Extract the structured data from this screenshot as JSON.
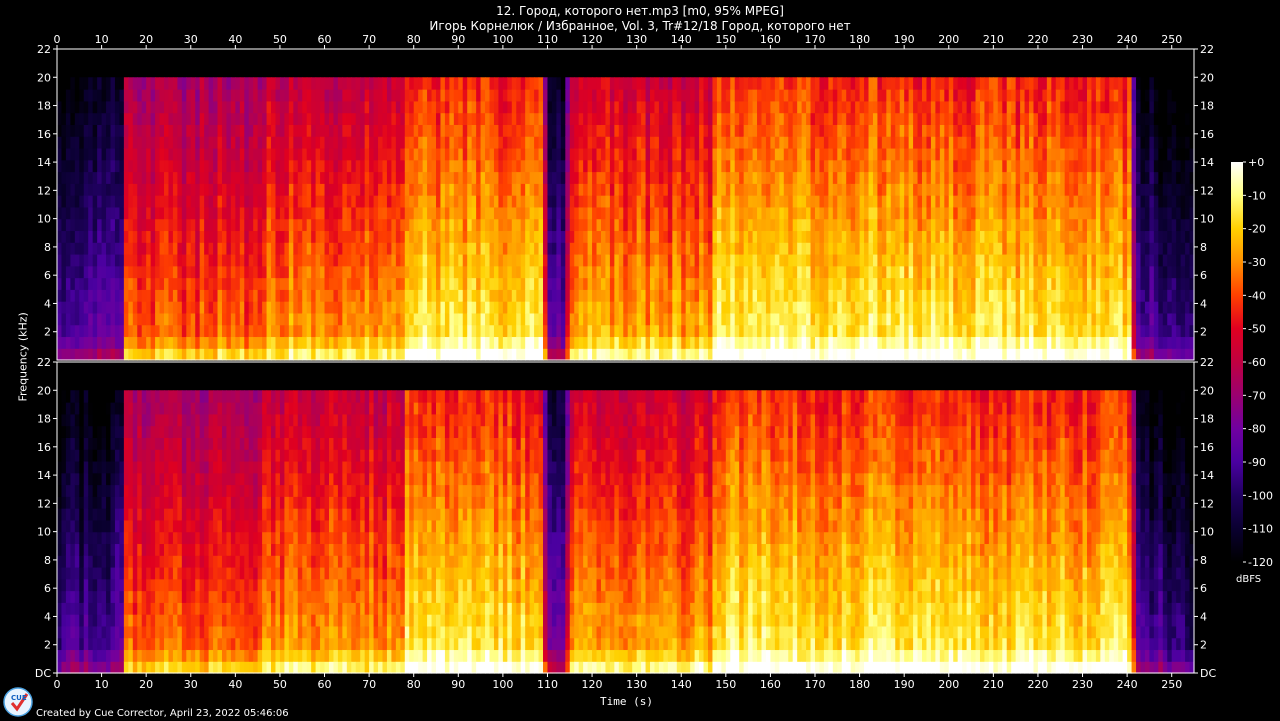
{
  "title": {
    "line1": "12. Город, которого нет.mp3 [m0, 95% MPEG]",
    "line2": "Игорь Корнелюк / Избранное, Vol. 3, Tr#12/18 Город, которого нет"
  },
  "footer": {
    "text": "Created by Cue Corrector, April 23, 2022 05:46:06",
    "logo_icon": "cue-corrector-logo",
    "logo_text": "CUE"
  },
  "chart_data": {
    "type": "heatmap",
    "title": "12. Город, которого нет.mp3 [m0, 95% MPEG]",
    "subtitle": "Игорь Корнелюк / Избранное, Vol. 3, Tr#12/18 Город, которого нет",
    "xlabel": "Time (s)",
    "ylabel": "Frequency (kHz)",
    "xlim": [
      0,
      255
    ],
    "ylim": [
      0,
      22
    ],
    "x_ticks": [
      0,
      10,
      20,
      30,
      40,
      50,
      60,
      70,
      80,
      90,
      100,
      110,
      120,
      130,
      140,
      150,
      160,
      170,
      180,
      190,
      200,
      210,
      220,
      230,
      240,
      250
    ],
    "channels": [
      {
        "y_ticks": [
          "2",
          "4",
          "6",
          "8",
          "10",
          "12",
          "14",
          "16",
          "18",
          "20",
          "22"
        ]
      },
      {
        "y_ticks": [
          "DC",
          "2",
          "4",
          "6",
          "8",
          "10",
          "12",
          "14",
          "16",
          "18",
          "20",
          "22"
        ]
      }
    ],
    "cutoff_khz": 20,
    "colorbar": {
      "unit": "dBFS",
      "range": [
        -120,
        0
      ],
      "ticks": [
        "+0",
        "-10",
        "-20",
        "-30",
        "-40",
        "-50",
        "-60",
        "-70",
        "-80",
        "-90",
        "-100",
        "-110",
        "-120"
      ],
      "colors": [
        "#ffffff",
        "#ffff80",
        "#ffd000",
        "#ff9000",
        "#ff4000",
        "#e00020",
        "#c00040",
        "#9a0070",
        "#7000a0",
        "#4a00a0",
        "#200060",
        "#0a0030",
        "#000000"
      ]
    },
    "energy_profile": {
      "times": [
        0,
        14,
        15,
        45,
        46,
        77,
        78,
        108,
        110,
        113,
        115,
        146,
        148,
        240,
        242,
        255
      ],
      "levels": [
        0.25,
        0.3,
        0.72,
        0.72,
        0.78,
        0.78,
        0.9,
        0.88,
        0.35,
        0.35,
        0.8,
        0.8,
        0.92,
        0.88,
        0.3,
        0.2
      ]
    }
  }
}
